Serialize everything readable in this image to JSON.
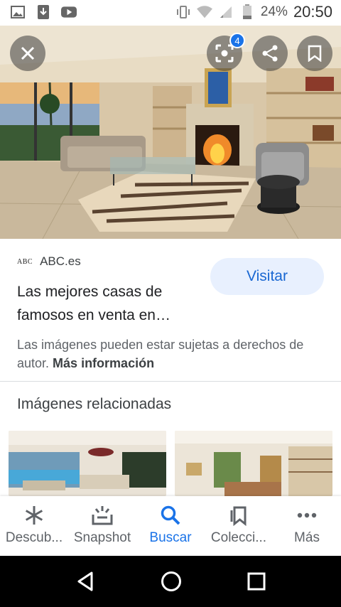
{
  "status_bar": {
    "battery": "24%",
    "time": "20:50",
    "left_icons": [
      "gallery-icon",
      "download-icon",
      "youtube-icon"
    ],
    "right_icons": [
      "vibrate-icon",
      "wifi-icon",
      "signal-icon",
      "battery-icon"
    ]
  },
  "hero": {
    "lens_badge": "4",
    "buttons": [
      "close-icon",
      "lens-icon",
      "share-icon",
      "bookmark-icon"
    ]
  },
  "result": {
    "source_logo": "ABC",
    "source_name": "ABC.es",
    "visit_label": "Visitar",
    "title": "Las mejores casas de famosos en venta en…",
    "notice_text": "Las imágenes pueden estar sujetas a derechos de autor. ",
    "notice_link": "Más información"
  },
  "related": {
    "title": "Imágenes relacionadas"
  },
  "bottom_nav": {
    "items": [
      {
        "label": "Descub...",
        "icon": "asterisk-icon"
      },
      {
        "label": "Snapshot",
        "icon": "snapshot-icon"
      },
      {
        "label": "Buscar",
        "icon": "search-icon"
      },
      {
        "label": "Colecci...",
        "icon": "collections-icon"
      },
      {
        "label": "Más",
        "icon": "more-icon"
      }
    ],
    "active_index": 2
  },
  "colors": {
    "accent": "#1a73e8",
    "visit_bg": "#e8f0fe",
    "text_primary": "#202124",
    "text_secondary": "#5f6368"
  }
}
